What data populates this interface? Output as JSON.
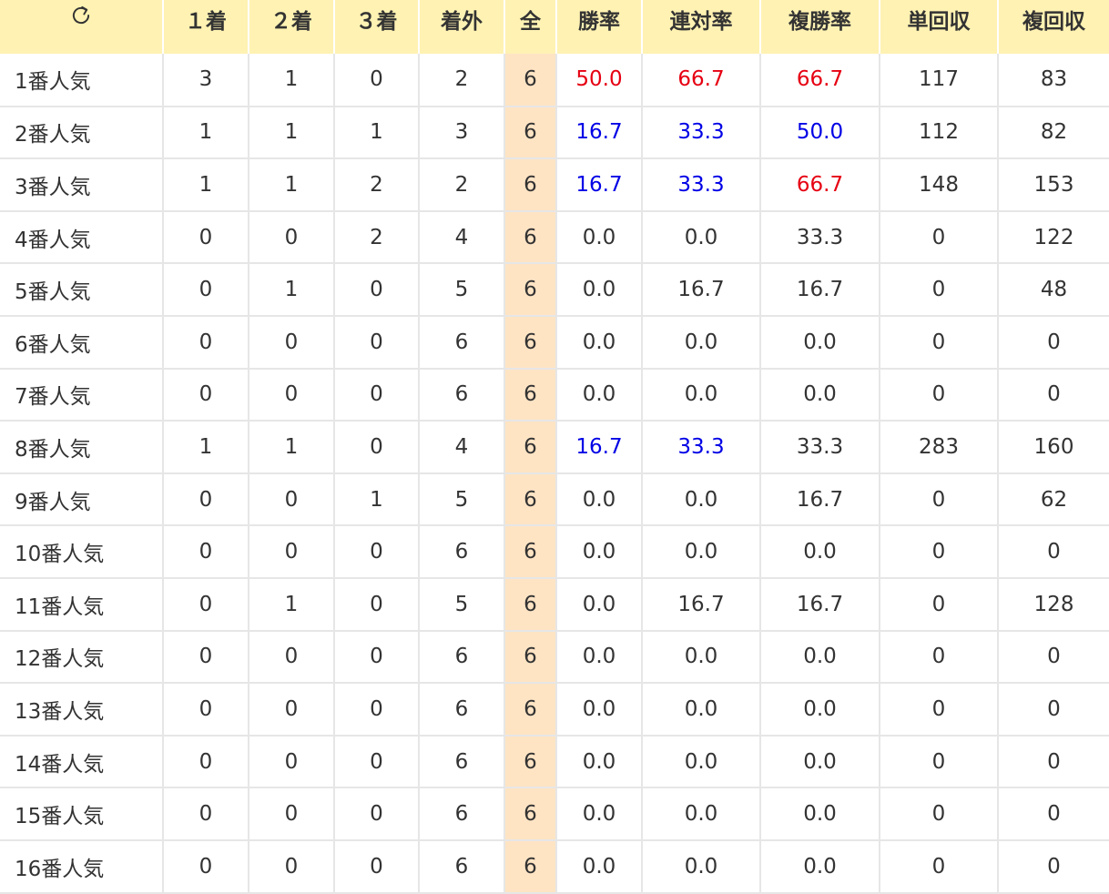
{
  "colors": {
    "header_bg": "#fff2b3",
    "total_column_bg": "#ffe4c4",
    "high_rate": "#e60012",
    "mid_rate": "#0000e6",
    "default_text": "#333333"
  },
  "header": {
    "refresh_icon": "refresh-icon",
    "columns": [
      "１着",
      "２着",
      "３着",
      "着外",
      "全",
      "勝率",
      "連対率",
      "複勝率",
      "単回収",
      "複回収"
    ]
  },
  "rows": [
    {
      "label": "1番人気",
      "first": "3",
      "second": "1",
      "third": "0",
      "out": "2",
      "total": "6",
      "win_rate": "50.0",
      "win_rate_color": "#e60012",
      "quinella_rate": "66.7",
      "quinella_rate_color": "#e60012",
      "place_rate": "66.7",
      "place_rate_color": "#e60012",
      "win_return": "117",
      "place_return": "83"
    },
    {
      "label": "2番人気",
      "first": "1",
      "second": "1",
      "third": "1",
      "out": "3",
      "total": "6",
      "win_rate": "16.7",
      "win_rate_color": "#0000e6",
      "quinella_rate": "33.3",
      "quinella_rate_color": "#0000e6",
      "place_rate": "50.0",
      "place_rate_color": "#0000e6",
      "win_return": "112",
      "place_return": "82"
    },
    {
      "label": "3番人気",
      "first": "1",
      "second": "1",
      "third": "2",
      "out": "2",
      "total": "6",
      "win_rate": "16.7",
      "win_rate_color": "#0000e6",
      "quinella_rate": "33.3",
      "quinella_rate_color": "#0000e6",
      "place_rate": "66.7",
      "place_rate_color": "#e60012",
      "win_return": "148",
      "place_return": "153"
    },
    {
      "label": "4番人気",
      "first": "0",
      "second": "0",
      "third": "2",
      "out": "4",
      "total": "6",
      "win_rate": "0.0",
      "win_rate_color": "#333333",
      "quinella_rate": "0.0",
      "quinella_rate_color": "#333333",
      "place_rate": "33.3",
      "place_rate_color": "#333333",
      "win_return": "0",
      "place_return": "122"
    },
    {
      "label": "5番人気",
      "first": "0",
      "second": "1",
      "third": "0",
      "out": "5",
      "total": "6",
      "win_rate": "0.0",
      "win_rate_color": "#333333",
      "quinella_rate": "16.7",
      "quinella_rate_color": "#333333",
      "place_rate": "16.7",
      "place_rate_color": "#333333",
      "win_return": "0",
      "place_return": "48"
    },
    {
      "label": "6番人気",
      "first": "0",
      "second": "0",
      "third": "0",
      "out": "6",
      "total": "6",
      "win_rate": "0.0",
      "win_rate_color": "#333333",
      "quinella_rate": "0.0",
      "quinella_rate_color": "#333333",
      "place_rate": "0.0",
      "place_rate_color": "#333333",
      "win_return": "0",
      "place_return": "0"
    },
    {
      "label": "7番人気",
      "first": "0",
      "second": "0",
      "third": "0",
      "out": "6",
      "total": "6",
      "win_rate": "0.0",
      "win_rate_color": "#333333",
      "quinella_rate": "0.0",
      "quinella_rate_color": "#333333",
      "place_rate": "0.0",
      "place_rate_color": "#333333",
      "win_return": "0",
      "place_return": "0"
    },
    {
      "label": "8番人気",
      "first": "1",
      "second": "1",
      "third": "0",
      "out": "4",
      "total": "6",
      "win_rate": "16.7",
      "win_rate_color": "#0000e6",
      "quinella_rate": "33.3",
      "quinella_rate_color": "#0000e6",
      "place_rate": "33.3",
      "place_rate_color": "#333333",
      "win_return": "283",
      "place_return": "160"
    },
    {
      "label": "9番人気",
      "first": "0",
      "second": "0",
      "third": "1",
      "out": "5",
      "total": "6",
      "win_rate": "0.0",
      "win_rate_color": "#333333",
      "quinella_rate": "0.0",
      "quinella_rate_color": "#333333",
      "place_rate": "16.7",
      "place_rate_color": "#333333",
      "win_return": "0",
      "place_return": "62"
    },
    {
      "label": "10番人気",
      "first": "0",
      "second": "0",
      "third": "0",
      "out": "6",
      "total": "6",
      "win_rate": "0.0",
      "win_rate_color": "#333333",
      "quinella_rate": "0.0",
      "quinella_rate_color": "#333333",
      "place_rate": "0.0",
      "place_rate_color": "#333333",
      "win_return": "0",
      "place_return": "0"
    },
    {
      "label": "11番人気",
      "first": "0",
      "second": "1",
      "third": "0",
      "out": "5",
      "total": "6",
      "win_rate": "0.0",
      "win_rate_color": "#333333",
      "quinella_rate": "16.7",
      "quinella_rate_color": "#333333",
      "place_rate": "16.7",
      "place_rate_color": "#333333",
      "win_return": "0",
      "place_return": "128"
    },
    {
      "label": "12番人気",
      "first": "0",
      "second": "0",
      "third": "0",
      "out": "6",
      "total": "6",
      "win_rate": "0.0",
      "win_rate_color": "#333333",
      "quinella_rate": "0.0",
      "quinella_rate_color": "#333333",
      "place_rate": "0.0",
      "place_rate_color": "#333333",
      "win_return": "0",
      "place_return": "0"
    },
    {
      "label": "13番人気",
      "first": "0",
      "second": "0",
      "third": "0",
      "out": "6",
      "total": "6",
      "win_rate": "0.0",
      "win_rate_color": "#333333",
      "quinella_rate": "0.0",
      "quinella_rate_color": "#333333",
      "place_rate": "0.0",
      "place_rate_color": "#333333",
      "win_return": "0",
      "place_return": "0"
    },
    {
      "label": "14番人気",
      "first": "0",
      "second": "0",
      "third": "0",
      "out": "6",
      "total": "6",
      "win_rate": "0.0",
      "win_rate_color": "#333333",
      "quinella_rate": "0.0",
      "quinella_rate_color": "#333333",
      "place_rate": "0.0",
      "place_rate_color": "#333333",
      "win_return": "0",
      "place_return": "0"
    },
    {
      "label": "15番人気",
      "first": "0",
      "second": "0",
      "third": "0",
      "out": "6",
      "total": "6",
      "win_rate": "0.0",
      "win_rate_color": "#333333",
      "quinella_rate": "0.0",
      "quinella_rate_color": "#333333",
      "place_rate": "0.0",
      "place_rate_color": "#333333",
      "win_return": "0",
      "place_return": "0"
    },
    {
      "label": "16番人気",
      "first": "0",
      "second": "0",
      "third": "0",
      "out": "6",
      "total": "6",
      "win_rate": "0.0",
      "win_rate_color": "#333333",
      "quinella_rate": "0.0",
      "quinella_rate_color": "#333333",
      "place_rate": "0.0",
      "place_rate_color": "#333333",
      "win_return": "0",
      "place_return": "0"
    }
  ]
}
